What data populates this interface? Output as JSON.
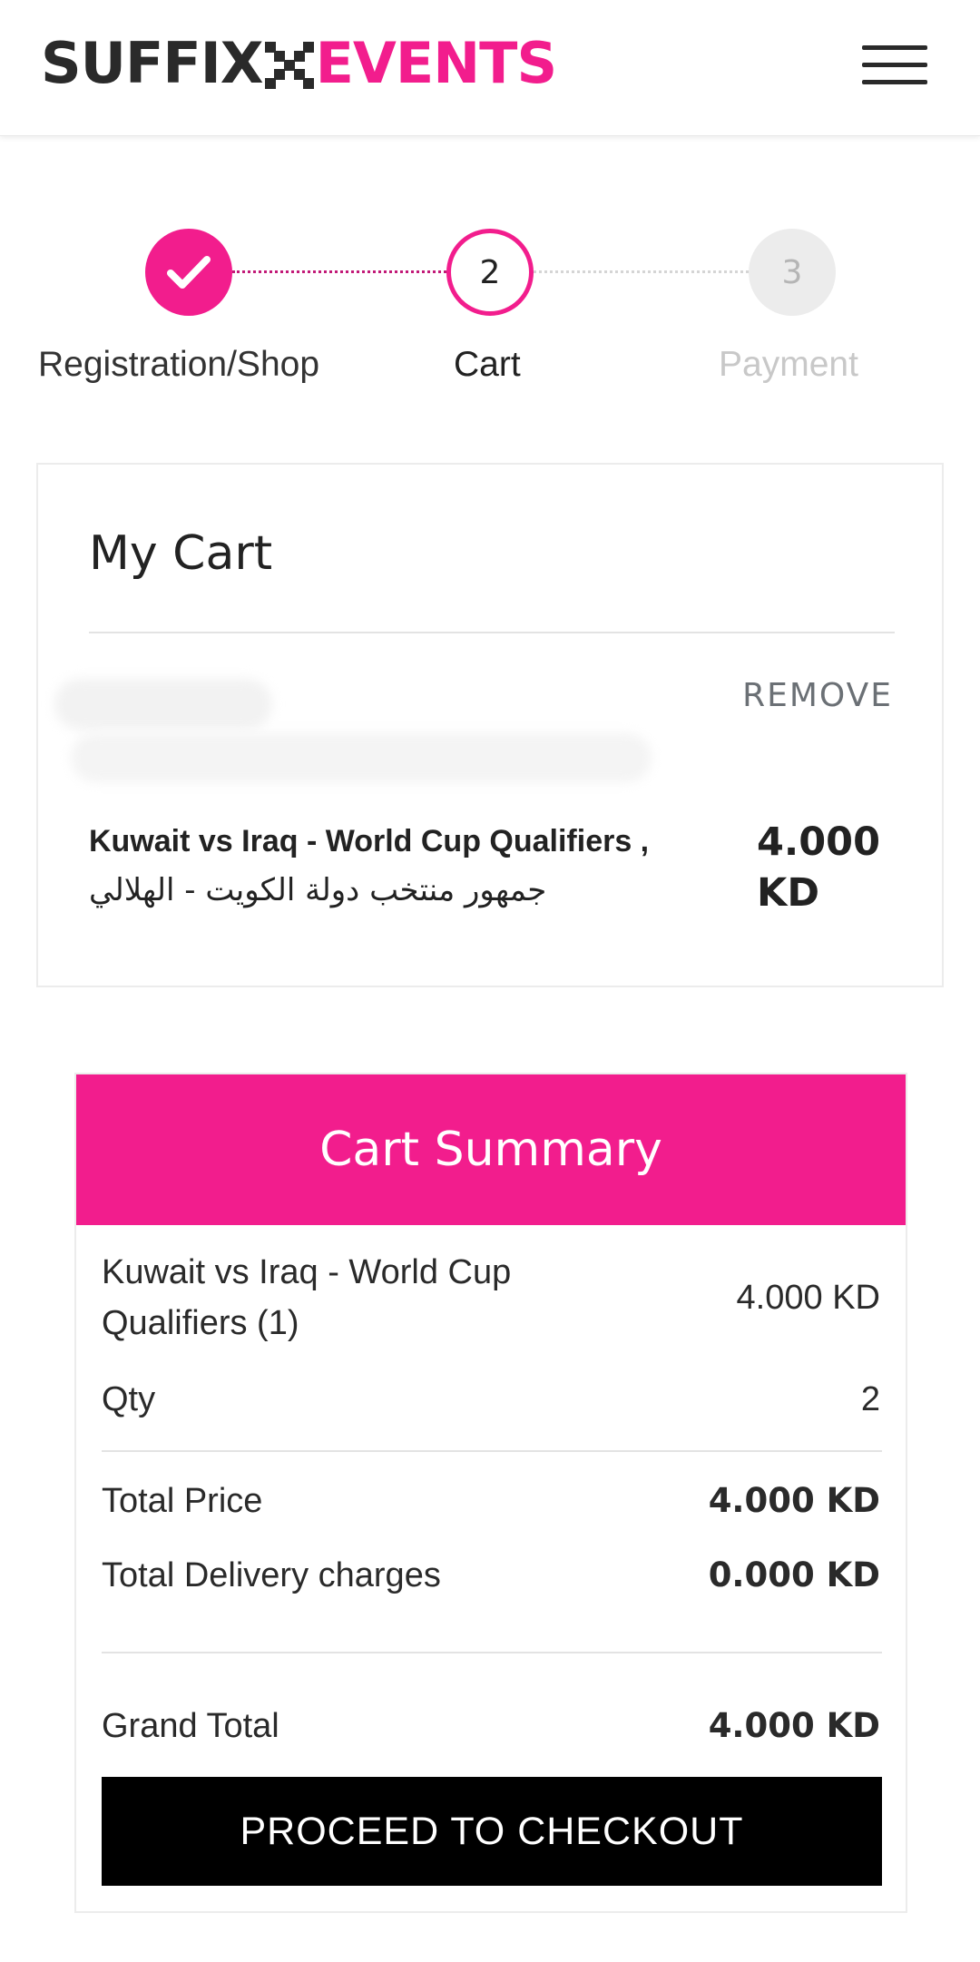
{
  "brand": {
    "part1": "SUFFIX",
    "part2": "EVENTS",
    "accent": "#f21d8d"
  },
  "header": {
    "menu_icon": "hamburger-menu-icon"
  },
  "stepper": {
    "steps": [
      {
        "number": "1",
        "label": "Registration/Shop",
        "state": "completed",
        "icon": "check-icon"
      },
      {
        "number": "2",
        "label": "Cart",
        "state": "active"
      },
      {
        "number": "3",
        "label": "Payment",
        "state": "inactive"
      }
    ]
  },
  "cart": {
    "title": "My Cart",
    "remove_label": "REMOVE",
    "item": {
      "name": "Kuwait vs Iraq - World Cup Qualifiers ,",
      "name_ar": "جمهور منتخب دولة الكويت - الهلالي",
      "price": "4.000 KD"
    }
  },
  "summary": {
    "title": "Cart Summary",
    "item_label": "Kuwait vs Iraq - World Cup Qualifiers (1)",
    "item_value": "4.000 KD",
    "qty_label": "Qty",
    "qty_value": "2",
    "total_price_label": "Total Price",
    "total_price_value": "4.000 KD",
    "delivery_label": "Total Delivery charges",
    "delivery_value": "0.000 KD",
    "grand_total_label": "Grand Total",
    "grand_total_value": "4.000 KD",
    "checkout_label": "PROCEED TO CHECKOUT"
  }
}
